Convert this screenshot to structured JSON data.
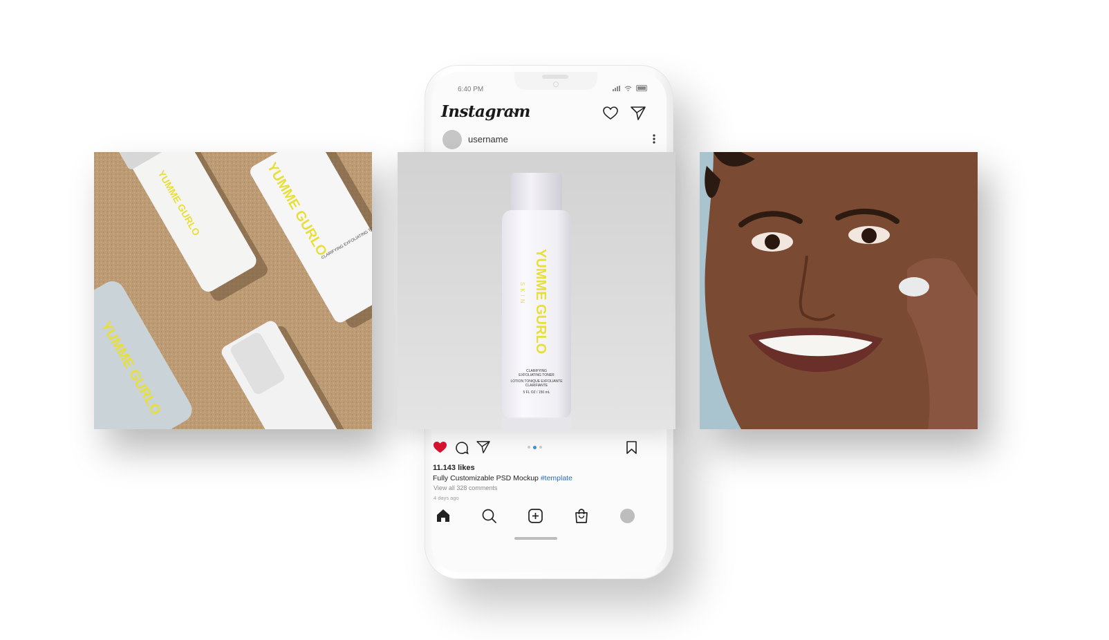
{
  "status_bar": {
    "time": "6:40 PM"
  },
  "header": {
    "logo_text": "Instagram",
    "icons": [
      "heart-icon",
      "send-icon"
    ]
  },
  "post": {
    "username": "username",
    "carousel": {
      "count": 3,
      "active_index": 1
    },
    "liked": true,
    "likes": "11.143 likes",
    "caption": "Fully Customizable PSD Mockup",
    "hashtag": "#template",
    "comments_link": "View all 328 comments",
    "time_ago": "4 days ago",
    "action_icons": [
      "heart-icon",
      "comment-icon",
      "share-icon",
      "bookmark-icon"
    ]
  },
  "product": {
    "brand_main": "YUMME GURLO",
    "brand_sub": "SKIN",
    "toner_line1": "CLARIFYING",
    "toner_line2": "EXFOLIATING TONER",
    "toner_fr": "LOTION TONIQUE EXFOLIANTE CLARIFIANTE",
    "toner_size": "5 FL OZ / 150 mL"
  },
  "bottom_nav": [
    "home-icon",
    "search-icon",
    "add-post-icon",
    "shop-icon",
    "profile-avatar"
  ],
  "colors": {
    "like_red": "#d3132f",
    "hashtag_blue": "#2a6fb0",
    "brand_yellow": "#e8df3a",
    "active_dot": "#3a8fd6"
  }
}
